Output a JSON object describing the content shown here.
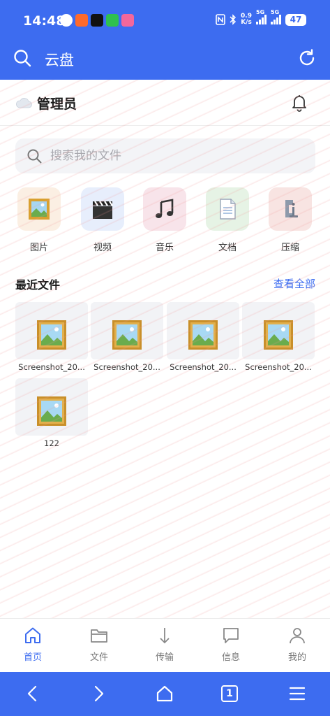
{
  "status_bar": {
    "time": "14:48",
    "net_speed_value": "0.9",
    "net_speed_unit": "K/s",
    "sim1": "5G",
    "sim2": "5G",
    "battery": "47"
  },
  "appbar": {
    "title": "云盘"
  },
  "user": {
    "name": "管理员"
  },
  "search": {
    "placeholder": "搜索我的文件"
  },
  "categories": [
    {
      "label": "图片",
      "icon": "picture-icon",
      "bg": "#fbefe3"
    },
    {
      "label": "视频",
      "icon": "clapperboard-icon",
      "bg": "#e7eefc"
    },
    {
      "label": "音乐",
      "icon": "music-note-icon",
      "bg": "#f8e4ea"
    },
    {
      "label": "文档",
      "icon": "document-icon",
      "bg": "#e6f3e5"
    },
    {
      "label": "压缩",
      "icon": "clamp-icon",
      "bg": "#f8e4e2"
    }
  ],
  "recent": {
    "title": "最近文件",
    "see_all": "查看全部",
    "files": [
      {
        "name": "Screenshot_20..."
      },
      {
        "name": "Screenshot_20..."
      },
      {
        "name": "Screenshot_20..."
      },
      {
        "name": "Screenshot_20..."
      },
      {
        "name": "122"
      }
    ]
  },
  "bottom_nav": [
    {
      "label": "首页",
      "icon": "home-icon",
      "active": true
    },
    {
      "label": "文件",
      "icon": "folder-icon",
      "active": false
    },
    {
      "label": "传输",
      "icon": "download-arrow-icon",
      "active": false
    },
    {
      "label": "信息",
      "icon": "message-icon",
      "active": false
    },
    {
      "label": "我的",
      "icon": "person-icon",
      "active": false
    }
  ],
  "system_nav": {
    "tab_count": "1"
  },
  "colors": {
    "accent": "#3d6cf0"
  }
}
